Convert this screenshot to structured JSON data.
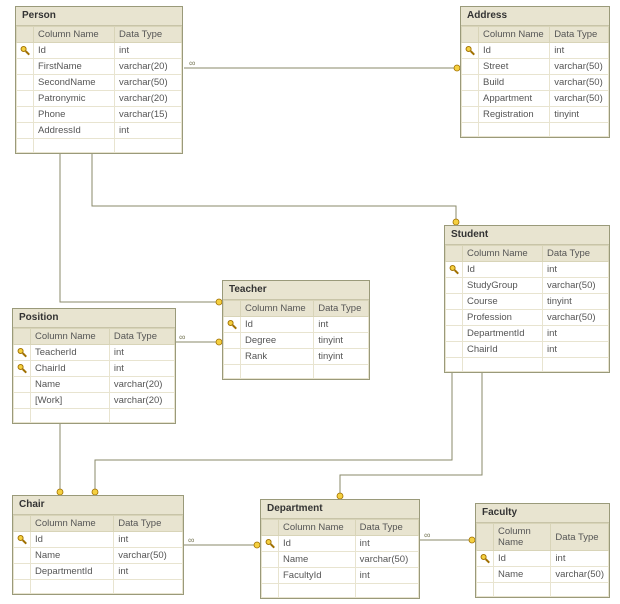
{
  "diagram": {
    "column_header": "Column Name",
    "type_header": "Data Type",
    "entities": {
      "person": {
        "title": "Person",
        "rows": [
          {
            "pk": true,
            "name": "Id",
            "type": "int"
          },
          {
            "pk": false,
            "name": "FirstName",
            "type": "varchar(20)"
          },
          {
            "pk": false,
            "name": "SecondName",
            "type": "varchar(50)"
          },
          {
            "pk": false,
            "name": "Patronymic",
            "type": "varchar(20)"
          },
          {
            "pk": false,
            "name": "Phone",
            "type": "varchar(15)"
          },
          {
            "pk": false,
            "name": "AddressId",
            "type": "int"
          }
        ]
      },
      "address": {
        "title": "Address",
        "rows": [
          {
            "pk": true,
            "name": "Id",
            "type": "int"
          },
          {
            "pk": false,
            "name": "Street",
            "type": "varchar(50)"
          },
          {
            "pk": false,
            "name": "Build",
            "type": "varchar(50)"
          },
          {
            "pk": false,
            "name": "Appartment",
            "type": "varchar(50)"
          },
          {
            "pk": false,
            "name": "Registration",
            "type": "tinyint"
          }
        ]
      },
      "student": {
        "title": "Student",
        "rows": [
          {
            "pk": true,
            "name": "Id",
            "type": "int"
          },
          {
            "pk": false,
            "name": "StudyGroup",
            "type": "varchar(50)"
          },
          {
            "pk": false,
            "name": "Course",
            "type": "tinyint"
          },
          {
            "pk": false,
            "name": "Profession",
            "type": "varchar(50)"
          },
          {
            "pk": false,
            "name": "DepartmentId",
            "type": "int"
          },
          {
            "pk": false,
            "name": "ChairId",
            "type": "int"
          }
        ]
      },
      "teacher": {
        "title": "Teacher",
        "rows": [
          {
            "pk": true,
            "name": "Id",
            "type": "int"
          },
          {
            "pk": false,
            "name": "Degree",
            "type": "tinyint"
          },
          {
            "pk": false,
            "name": "Rank",
            "type": "tinyint"
          }
        ]
      },
      "position": {
        "title": "Position",
        "rows": [
          {
            "pk": true,
            "name": "TeacherId",
            "type": "int"
          },
          {
            "pk": true,
            "name": "ChairId",
            "type": "int"
          },
          {
            "pk": false,
            "name": "Name",
            "type": "varchar(20)"
          },
          {
            "pk": false,
            "name": "[Work]",
            "type": "varchar(20)"
          }
        ]
      },
      "chair": {
        "title": "Chair",
        "rows": [
          {
            "pk": true,
            "name": "Id",
            "type": "int"
          },
          {
            "pk": false,
            "name": "Name",
            "type": "varchar(50)"
          },
          {
            "pk": false,
            "name": "DepartmentId",
            "type": "int"
          }
        ]
      },
      "department": {
        "title": "Department",
        "rows": [
          {
            "pk": true,
            "name": "Id",
            "type": "int"
          },
          {
            "pk": false,
            "name": "Name",
            "type": "varchar(50)"
          },
          {
            "pk": false,
            "name": "FacultyId",
            "type": "int"
          }
        ]
      },
      "faculty": {
        "title": "Faculty",
        "rows": [
          {
            "pk": true,
            "name": "Id",
            "type": "int"
          },
          {
            "pk": false,
            "name": "Name",
            "type": "varchar(50)"
          }
        ]
      }
    }
  }
}
